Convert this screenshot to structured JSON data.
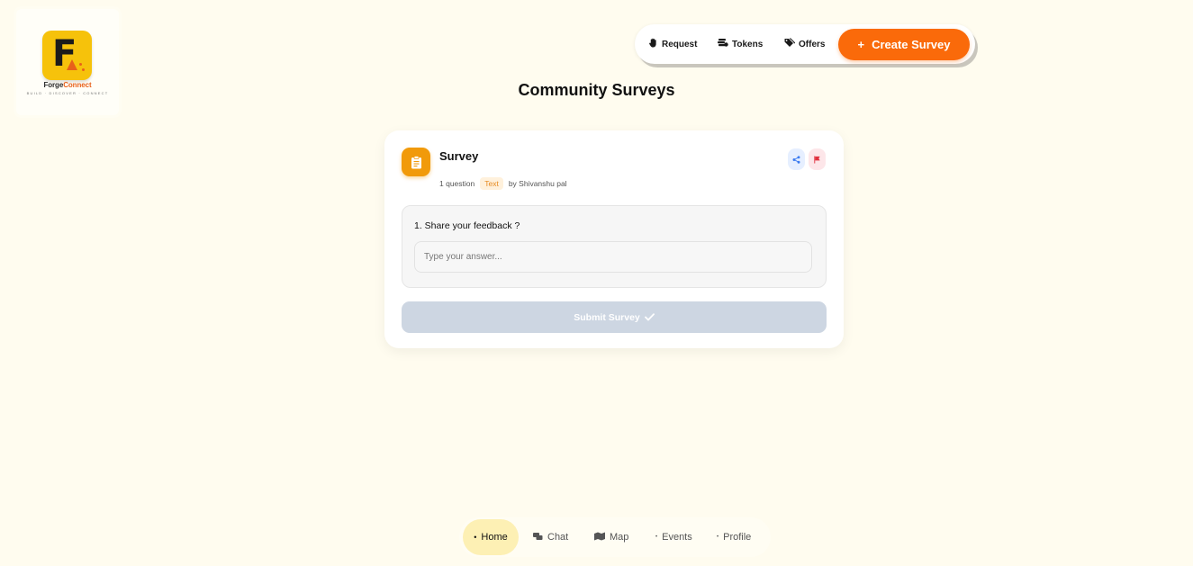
{
  "brand": {
    "name_part1": "Forge",
    "name_part2": "Connect",
    "tagline": "BUILD · DISCOVER · CONNECT",
    "logo_letter": "F",
    "accent_color": "#fa6a0a",
    "tile_color": "#f6c20b"
  },
  "topnav": {
    "items": [
      {
        "label": "Request",
        "icon": "hand-icon"
      },
      {
        "label": "Tokens",
        "icon": "coins-icon"
      },
      {
        "label": "Offers",
        "icon": "tags-icon"
      }
    ],
    "create_button": {
      "icon": "+",
      "label": "Create Survey"
    }
  },
  "page": {
    "title": "Community Surveys"
  },
  "survey": {
    "title": "Survey",
    "question_count": "1 question",
    "type": "Text",
    "author": "by Shivanshu pal",
    "questions": [
      {
        "label": "1. Share your feedback ?",
        "placeholder": "Type your answer...",
        "value": ""
      }
    ],
    "submit_label": "Submit Survey",
    "submit_color": "#cdd6e2"
  },
  "bottomnav": {
    "items": [
      {
        "label": "Home",
        "icon": "home-icon",
        "active": true
      },
      {
        "label": "Chat",
        "icon": "chat-icon",
        "active": false
      },
      {
        "label": "Map",
        "icon": "map-icon",
        "active": false
      },
      {
        "label": "Events",
        "icon": "events-icon",
        "active": false
      },
      {
        "label": "Profile",
        "icon": "profile-icon",
        "active": false
      }
    ]
  }
}
